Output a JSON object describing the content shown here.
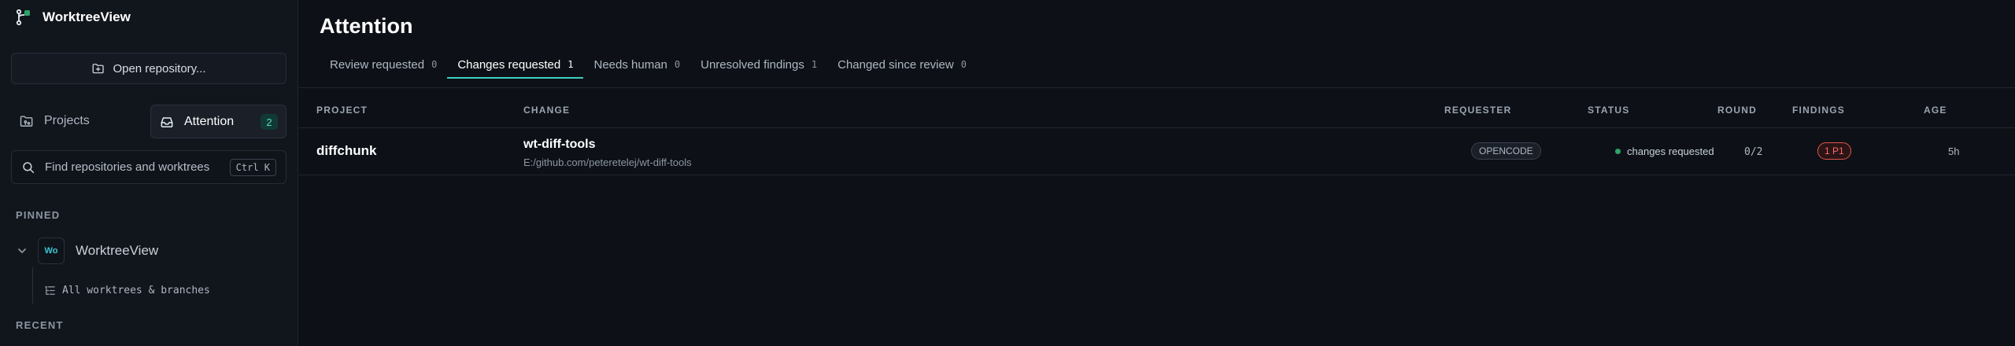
{
  "app": {
    "name": "WorktreeView"
  },
  "sidebar": {
    "open_repo_label": "Open repository...",
    "nav": {
      "projects_label": "Projects",
      "attention_label": "Attention",
      "attention_count": "2"
    },
    "search": {
      "placeholder": "Find repositories and worktrees",
      "shortcut": "Ctrl K"
    },
    "pinned_label": "PINNED",
    "pinned": [
      {
        "avatar": "Wo",
        "name": "WorktreeView",
        "sub_label": "All worktrees & branches"
      }
    ],
    "recent_label": "RECENT"
  },
  "main": {
    "title": "Attention",
    "tabs": [
      {
        "label": "Review requested",
        "count": "0"
      },
      {
        "label": "Changes requested",
        "count": "1",
        "active": true
      },
      {
        "label": "Needs human",
        "count": "0"
      },
      {
        "label": "Unresolved findings",
        "count": "1"
      },
      {
        "label": "Changed since review",
        "count": "0"
      }
    ],
    "columns": {
      "project": "PROJECT",
      "change": "CHANGE",
      "requester": "REQUESTER",
      "status": "STATUS",
      "round": "ROUND",
      "findings": "FINDINGS",
      "age": "AGE"
    },
    "rows": [
      {
        "project": "diffchunk",
        "change_title": "wt-diff-tools",
        "change_path": "E:/github.com/peteretelej/wt-diff-tools",
        "requester": "OPENCODE",
        "status": "changes requested",
        "round": "0/2",
        "findings": "1 P1",
        "age": "5h"
      }
    ]
  },
  "colors": {
    "accent": "#3fcfc1",
    "status_ok": "#2ea36a",
    "finding_p1": "#e5534b"
  }
}
